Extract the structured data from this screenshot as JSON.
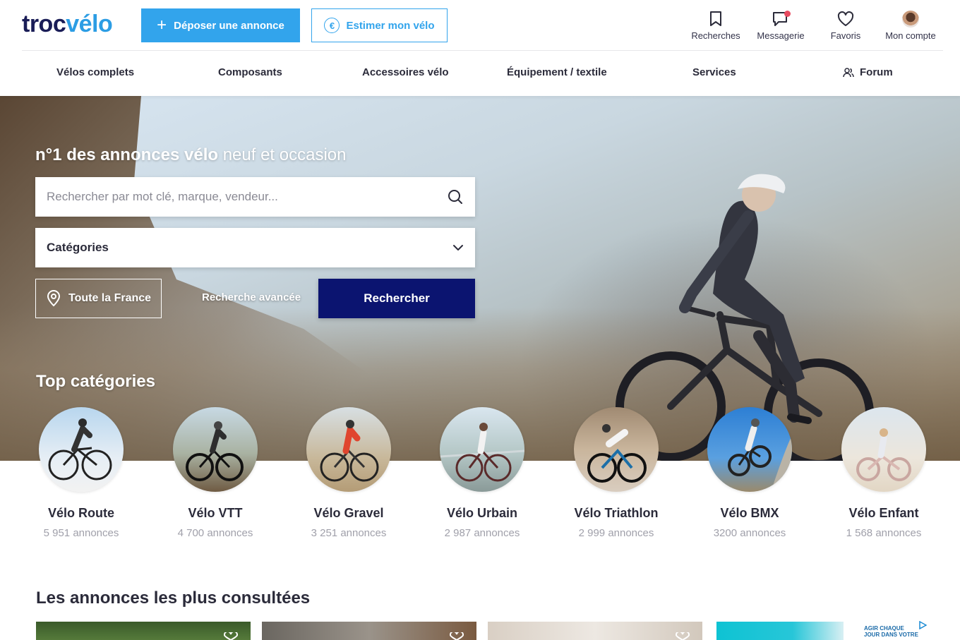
{
  "logo": {
    "part1": "troc",
    "part2": "vélo"
  },
  "header": {
    "deposit_label": "Déposer une annonce",
    "estimate_label": "Estimer mon vélo",
    "actions": [
      {
        "label": "Recherches",
        "icon": "bookmark-icon"
      },
      {
        "label": "Messagerie",
        "icon": "message-icon"
      },
      {
        "label": "Favoris",
        "icon": "heart-icon"
      },
      {
        "label": "Mon compte",
        "icon": "avatar"
      }
    ]
  },
  "nav": {
    "items": [
      {
        "label": "Vélos complets"
      },
      {
        "label": "Composants"
      },
      {
        "label": "Accessoires vélo"
      },
      {
        "label": "Équipement / textile"
      },
      {
        "label": "Services"
      },
      {
        "label": "Forum",
        "icon": "users-icon"
      }
    ]
  },
  "hero": {
    "title_bold": "n°1 des annonces vélo",
    "title_rest": " neuf et occasion",
    "search_placeholder": "Rechercher par mot clé, marque, vendeur...",
    "category_label": "Catégories",
    "location_label": "Toute la France",
    "advanced_label": "Recherche avancée",
    "search_button": "Rechercher",
    "top_categories_title": "Top catégories"
  },
  "categories": [
    {
      "name": "Vélo Route",
      "count": "5 951 annonces"
    },
    {
      "name": "Vélo VTT",
      "count": "4 700 annonces"
    },
    {
      "name": "Vélo Gravel",
      "count": "3 251 annonces"
    },
    {
      "name": "Vélo Urbain",
      "count": "2 987 annonces"
    },
    {
      "name": "Vélo Triathlon",
      "count": "2 999 annonces"
    },
    {
      "name": "Vélo BMX",
      "count": "3200 annonces"
    },
    {
      "name": "Vélo Enfant",
      "count": "1 568 annonces"
    }
  ],
  "most_viewed": {
    "title": "Les annonces les plus consultées",
    "ad_text_line1": "AGIR CHAQUE",
    "ad_text_line2": "JOUR DANS VOTRE"
  },
  "colors": {
    "brand_dark": "#1a1d57",
    "brand_blue": "#32a4ec",
    "search_button": "#0b1470",
    "notification": "#e84a5f"
  }
}
